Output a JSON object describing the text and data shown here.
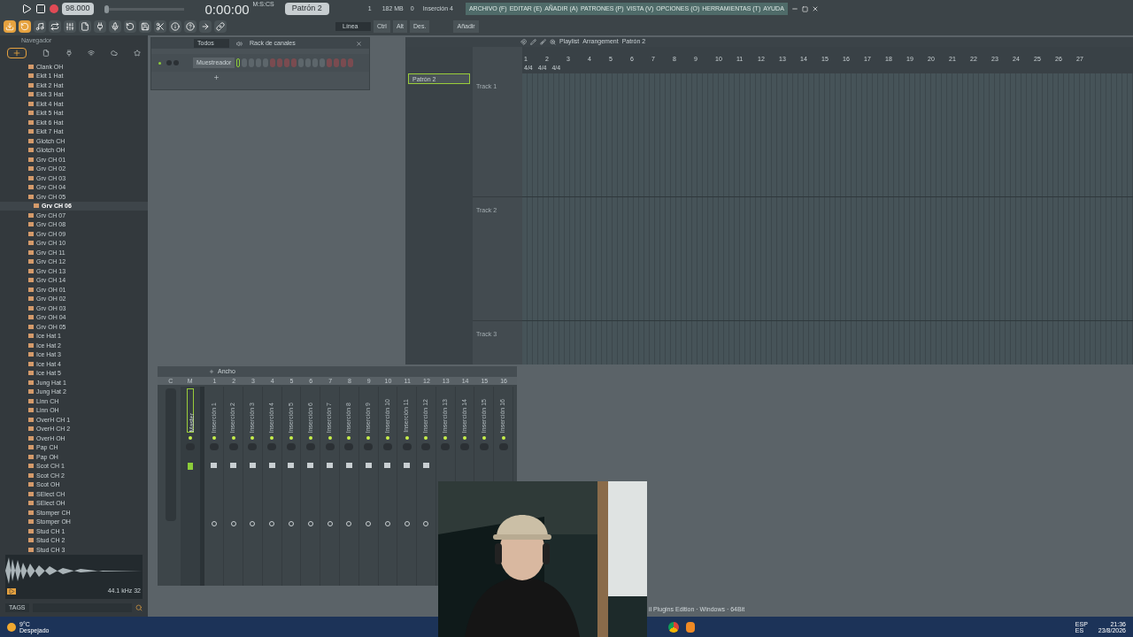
{
  "transport": {
    "tempo": "98.000",
    "time": "0:00:00",
    "time_format": "M:S:CS",
    "pattern": "Patrón 2",
    "cpu": "1",
    "memory": "182 MB",
    "polyphony": "0",
    "hint": "Inserción 4",
    "master_pitch": {
      "level": 0
    }
  },
  "menu": [
    "ARCHIVO (F)",
    "EDITAR (E)",
    "AÑADIR (A)",
    "PATRONES (P)",
    "VISTA (V)",
    "OPCIONES (O)",
    "HERRAMIENTAS (T)",
    "AYUDA"
  ],
  "toolbar": {
    "snap": "Línea",
    "buttons": [
      "Ctrl",
      "Alt",
      "Des."
    ],
    "add": "Añadir"
  },
  "browser": {
    "title": "Navegador",
    "items": [
      {
        "label": "Clank OH",
        "selected": false
      },
      {
        "label": "Ekit 1 Hat",
        "selected": false
      },
      {
        "label": "Ekit 2 Hat",
        "selected": false
      },
      {
        "label": "Ekit 3 Hat",
        "selected": false
      },
      {
        "label": "Ekit 4 Hat",
        "selected": false
      },
      {
        "label": "Ekit 5 Hat",
        "selected": false
      },
      {
        "label": "Ekit 6 Hat",
        "selected": false
      },
      {
        "label": "Ekit 7 Hat",
        "selected": false
      },
      {
        "label": "Glotch CH",
        "selected": false
      },
      {
        "label": "Glotch OH",
        "selected": false
      },
      {
        "label": "Grv CH 01",
        "selected": false
      },
      {
        "label": "Grv CH 02",
        "selected": false
      },
      {
        "label": "Grv CH 03",
        "selected": false
      },
      {
        "label": "Grv CH 04",
        "selected": false
      },
      {
        "label": "Grv CH 05",
        "selected": false
      },
      {
        "label": "Grv CH 06",
        "selected": true
      },
      {
        "label": "Grv CH 07",
        "selected": false
      },
      {
        "label": "Grv CH 08",
        "selected": false
      },
      {
        "label": "Grv CH 09",
        "selected": false
      },
      {
        "label": "Grv CH 10",
        "selected": false
      },
      {
        "label": "Grv CH 11",
        "selected": false
      },
      {
        "label": "Grv CH 12",
        "selected": false
      },
      {
        "label": "Grv CH 13",
        "selected": false
      },
      {
        "label": "Grv CH 14",
        "selected": false
      },
      {
        "label": "Grv OH 01",
        "selected": false
      },
      {
        "label": "Grv OH 02",
        "selected": false
      },
      {
        "label": "Grv OH 03",
        "selected": false
      },
      {
        "label": "Grv OH 04",
        "selected": false
      },
      {
        "label": "Grv OH 05",
        "selected": false
      },
      {
        "label": "Ice Hat 1",
        "selected": false
      },
      {
        "label": "Ice Hat 2",
        "selected": false
      },
      {
        "label": "Ice Hat 3",
        "selected": false
      },
      {
        "label": "Ice Hat 4",
        "selected": false
      },
      {
        "label": "Ice Hat 5",
        "selected": false
      },
      {
        "label": "Jung Hat 1",
        "selected": false
      },
      {
        "label": "Jung Hat 2",
        "selected": false
      },
      {
        "label": "Linn CH",
        "selected": false
      },
      {
        "label": "Linn OH",
        "selected": false
      },
      {
        "label": "OverH CH 1",
        "selected": false
      },
      {
        "label": "OverH CH 2",
        "selected": false
      },
      {
        "label": "OverH OH",
        "selected": false
      },
      {
        "label": "Pap CH",
        "selected": false
      },
      {
        "label": "Pap OH",
        "selected": false
      },
      {
        "label": "Scot CH 1",
        "selected": false
      },
      {
        "label": "Scot CH 2",
        "selected": false
      },
      {
        "label": "Scot OH",
        "selected": false
      },
      {
        "label": "SElect CH",
        "selected": false
      },
      {
        "label": "SElect OH",
        "selected": false
      },
      {
        "label": "Stomper CH",
        "selected": false
      },
      {
        "label": "Stomper OH",
        "selected": false
      },
      {
        "label": "Stud CH 1",
        "selected": false
      },
      {
        "label": "Stud CH 2",
        "selected": false
      },
      {
        "label": "Stud CH 3",
        "selected": false
      }
    ],
    "sample_info": "44.1 kHz 32",
    "tags_label": "TAGS"
  },
  "channel_rack": {
    "filter": "Todos",
    "title": "Rack de canales",
    "channels": [
      {
        "name": "Muestreador"
      }
    ]
  },
  "playlist": {
    "breadcrumb": [
      "Playlist",
      "Arrangement",
      "Patrón 2"
    ],
    "patterns": [
      {
        "label": "Patrón 2",
        "selected": true
      }
    ],
    "bars": [
      "1",
      "2",
      "3",
      "4",
      "5",
      "6",
      "7",
      "8",
      "9",
      "10",
      "11",
      "12",
      "13",
      "14",
      "15",
      "16",
      "17",
      "18",
      "19",
      "20",
      "21",
      "22",
      "23",
      "24",
      "25",
      "26",
      "27"
    ],
    "markers": [
      "4/4",
      "4/4",
      "4/4"
    ],
    "tracks": [
      "Track 1",
      "Track 2",
      "Track 3"
    ]
  },
  "mixer": {
    "title": "Ancho",
    "header": [
      "C",
      "M"
    ],
    "master": "Master",
    "inserts": [
      {
        "number": "1",
        "name": "Inserción 1"
      },
      {
        "number": "2",
        "name": "Inserción 2"
      },
      {
        "number": "3",
        "name": "Inserción 3"
      },
      {
        "number": "4",
        "name": "Inserción 4"
      },
      {
        "number": "5",
        "name": "Inserción 5"
      },
      {
        "number": "6",
        "name": "Inserción 6"
      },
      {
        "number": "7",
        "name": "Inserción 7"
      },
      {
        "number": "8",
        "name": "Inserción 8"
      },
      {
        "number": "9",
        "name": "Inserción 9"
      },
      {
        "number": "10",
        "name": "Inserción 10"
      },
      {
        "number": "11",
        "name": "Inserción 11"
      },
      {
        "number": "12",
        "name": "Inserción 12"
      },
      {
        "number": "13",
        "name": "Inserción 13"
      },
      {
        "number": "14",
        "name": "Inserción 14"
      },
      {
        "number": "15",
        "name": "Inserción 15"
      },
      {
        "number": "16",
        "name": "Inserción 16"
      }
    ]
  },
  "status": "il Plugins Edition · Windows · 64Bit",
  "taskbar": {
    "temperature": "9°C",
    "weather": "Despejado",
    "language": "ESP",
    "layout": "ES",
    "time": "21:36",
    "date": "23/8/2026"
  }
}
